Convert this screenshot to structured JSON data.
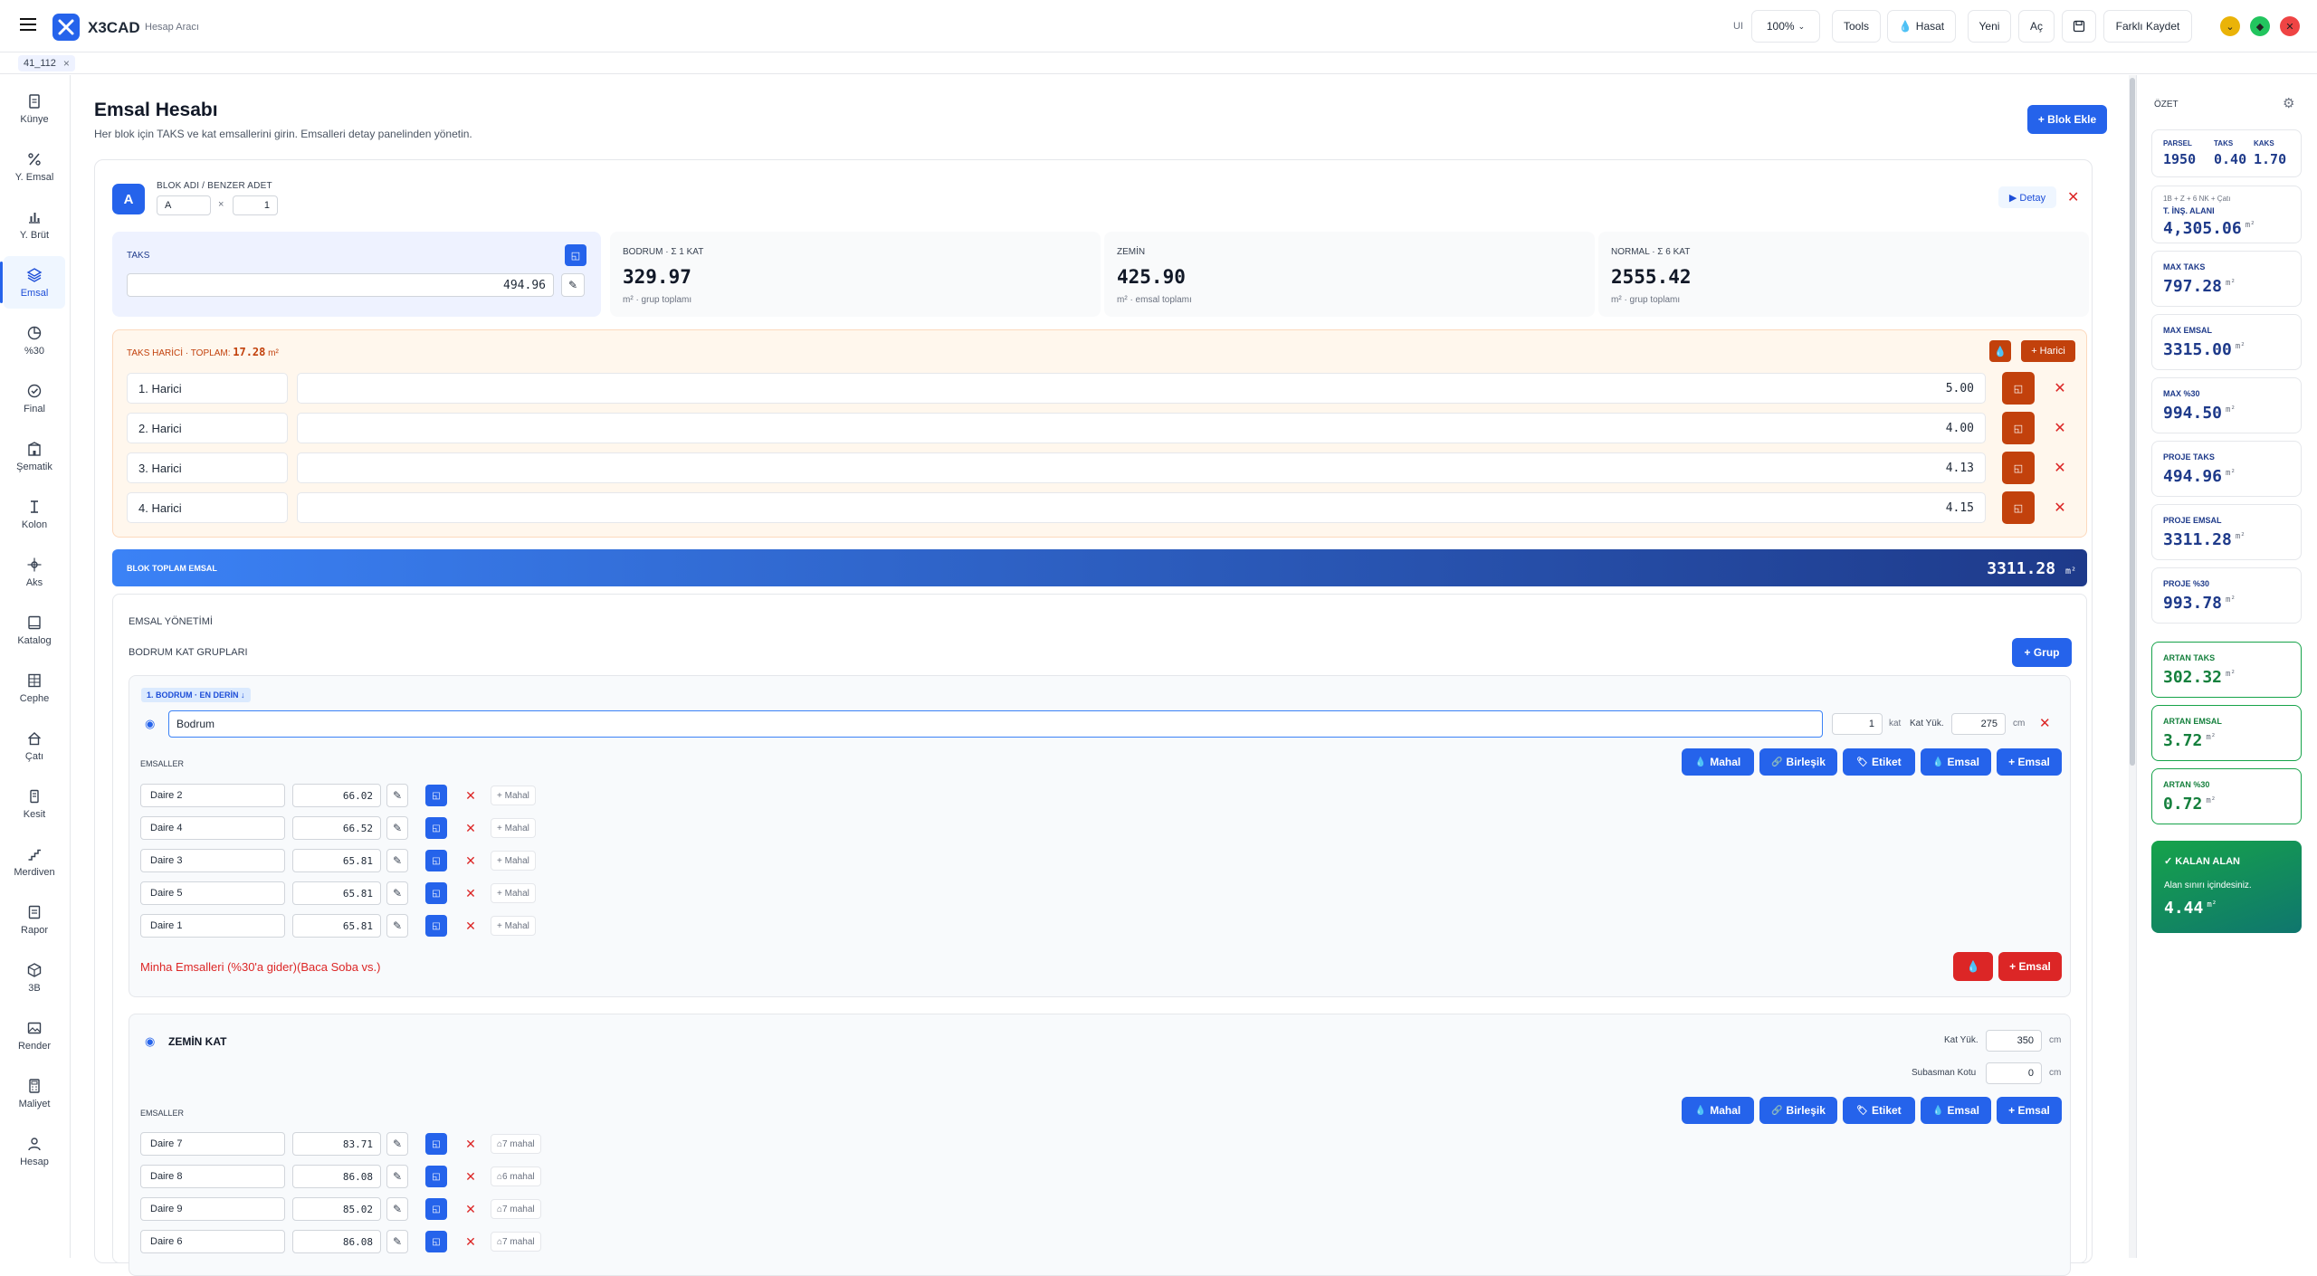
{
  "app": {
    "name": "X3CAD",
    "subtitle": "Hesap Aracı",
    "logo_letter": "X"
  },
  "tab": {
    "label": "41_112"
  },
  "toolbar": {
    "ui_label": "UI",
    "zoom": "100%",
    "tools": "Tools",
    "hasat": "Hasat",
    "yeni": "Yeni",
    "ac": "Aç",
    "farkli_kaydet": "Farklı Kaydet"
  },
  "nav": [
    {
      "label": "Künye",
      "icon": "document-icon"
    },
    {
      "label": "Y. Emsal",
      "icon": "percent-icon"
    },
    {
      "label": "Y. Brüt",
      "icon": "bar-chart-icon"
    },
    {
      "label": "Emsal",
      "icon": "layers-icon",
      "active": true
    },
    {
      "label": "%30",
      "icon": "pie-icon"
    },
    {
      "label": "Final",
      "icon": "check-circle-icon"
    },
    {
      "label": "Şematik",
      "icon": "building-icon"
    },
    {
      "label": "Kolon",
      "icon": "column-icon"
    },
    {
      "label": "Aks",
      "icon": "crosshair-icon"
    },
    {
      "label": "Katalog",
      "icon": "book-icon"
    },
    {
      "label": "Cephe",
      "icon": "facade-icon"
    },
    {
      "label": "Çatı",
      "icon": "home-icon"
    },
    {
      "label": "Kesit",
      "icon": "section-icon"
    },
    {
      "label": "Merdiven",
      "icon": "stairs-icon"
    },
    {
      "label": "Rapor",
      "icon": "report-icon"
    },
    {
      "label": "3B",
      "icon": "cube-icon"
    },
    {
      "label": "Render",
      "icon": "image-icon"
    },
    {
      "label": "Maliyet",
      "icon": "calculator-icon"
    },
    {
      "label": "Hesap",
      "icon": "user-icon"
    }
  ],
  "page": {
    "title": "Emsal Hesabı",
    "description": "Her blok için TAKS ve kat emsallerini girin. Emsalleri detay panelinden yönetin.",
    "add_block": "+ Blok Ekle"
  },
  "block": {
    "badge": "A",
    "name_label": "BLOK ADI / BENZER ADET",
    "name": "A",
    "times": "×",
    "count": "1",
    "detail_btn": "▶ Detay",
    "taks": {
      "label": "TAKS",
      "value": "494.96"
    },
    "stats": [
      {
        "title": "BODRUM · Σ 1 KAT",
        "value": "329.97",
        "sub": "m² · grup toplamı"
      },
      {
        "title": "ZEMİN",
        "value": "425.90",
        "sub": "m² · emsal toplamı"
      },
      {
        "title": "NORMAL · Σ 6 KAT",
        "value": "2555.42",
        "sub": "m² · grup toplamı"
      }
    ],
    "harici": {
      "title": "TAKS HARİCİ · TOPLAM:",
      "total": "17.28",
      "unit": "m²",
      "add_btn": "+ Harici",
      "rows": [
        {
          "name": "1. Harici",
          "value": "5.00"
        },
        {
          "name": "2. Harici",
          "value": "4.00"
        },
        {
          "name": "3. Harici",
          "value": "4.13"
        },
        {
          "name": "4. Harici",
          "value": "4.15"
        }
      ]
    },
    "total": {
      "label": "BLOK TOPLAM EMSAL",
      "value": "3311.28",
      "unit": "m²"
    }
  },
  "mgmt": {
    "title": "EMSAL YÖNETİMİ",
    "bodrum_groups": "BODRUM KAT GRUPLARI",
    "add_group": "+ Grup",
    "bodrum": {
      "tag": "1. BODRUM · EN DERİN ↓",
      "name": "Bodrum",
      "kat_count": "1",
      "kat_label": "kat",
      "kat_yuk_label": "Kat Yük.",
      "kat_yuk": "275",
      "unit_cm": "cm",
      "emsaller_label": "EMSALLER",
      "rows": [
        {
          "name": "Daire 2",
          "value": "66.02",
          "mahal": "+ Mahal"
        },
        {
          "name": "Daire 4",
          "value": "66.52",
          "mahal": "+ Mahal"
        },
        {
          "name": "Daire 3",
          "value": "65.81",
          "mahal": "+ Mahal"
        },
        {
          "name": "Daire 5",
          "value": "65.81",
          "mahal": "+ Mahal"
        },
        {
          "name": "Daire 1",
          "value": "65.81",
          "mahal": "+ Mahal"
        }
      ],
      "minha": "Minha Emsalleri (%30'a gider)(Baca Soba vs.)",
      "add_emsal": "+ Emsal"
    },
    "actions": [
      "Mahal",
      "Birleşik",
      "Etiket",
      "Emsal",
      "+ Emsal"
    ],
    "zemin": {
      "title": "ZEMİN KAT",
      "kat_yuk_label": "Kat Yük.",
      "kat_yuk": "350",
      "subasman_label": "Subasman Kotu",
      "subasman": "0",
      "unit_cm": "cm",
      "emsaller_label": "EMSALLER",
      "rows": [
        {
          "name": "Daire 7",
          "value": "83.71",
          "mahal": "7 mahal"
        },
        {
          "name": "Daire 8",
          "value": "86.08",
          "mahal": "6 mahal"
        },
        {
          "name": "Daire 9",
          "value": "85.02",
          "mahal": "7 mahal"
        },
        {
          "name": "Daire 6",
          "value": "86.08",
          "mahal": "7 mahal"
        }
      ]
    }
  },
  "summary": {
    "title": "ÖZET",
    "parsel_label": "PARSEL",
    "parsel": "1950",
    "taks_label": "TAKS",
    "taks": "0.40",
    "kaks_label": "KAKS",
    "kaks": "1.70",
    "ins_sub": "1B + Z + 6 NK + Çatı",
    "ins_label": "T. İNŞ. ALANI",
    "ins_value": "4,305.06",
    "unit": "m²",
    "cards": [
      {
        "label": "MAX TAKS",
        "value": "797.28"
      },
      {
        "label": "MAX EMSAL",
        "value": "3315.00"
      },
      {
        "label": "MAX %30",
        "value": "994.50"
      },
      {
        "label": "PROJE TAKS",
        "value": "494.96"
      },
      {
        "label": "PROJE EMSAL",
        "value": "3311.28"
      },
      {
        "label": "PROJE %30",
        "value": "993.78"
      }
    ],
    "green_cards": [
      {
        "label": "ARTAN TAKS",
        "value": "302.32"
      },
      {
        "label": "ARTAN EMSAL",
        "value": "3.72"
      },
      {
        "label": "ARTAN %30",
        "value": "0.72"
      }
    ],
    "kalan": {
      "title": "KALAN ALAN",
      "desc": "Alan sınırı içindesiniz.",
      "value": "4.44"
    }
  },
  "colors": {
    "accent": "#2563eb",
    "orange": "#c2410c",
    "green": "#16a34a",
    "danger": "#dc2626"
  }
}
